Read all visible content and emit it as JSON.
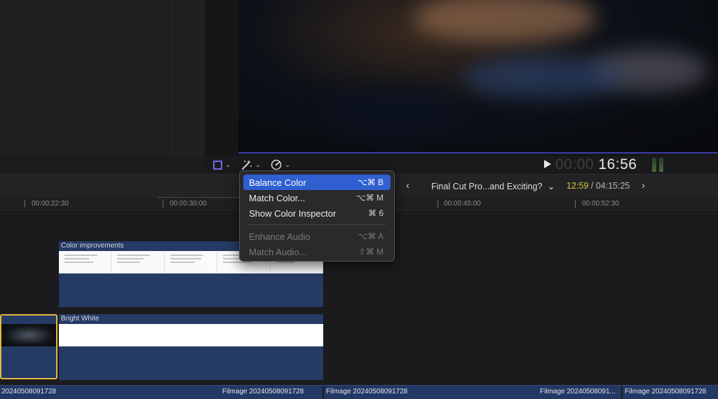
{
  "viewer": {
    "timecode_dim": "00:00",
    "timecode_bright": "16:56"
  },
  "timeline_header": {
    "back_arrow": "‹",
    "project_name": "Final Cut Pro...and Exciting?",
    "project_chevron": "⌄",
    "current_duration": "12:59",
    "duration_separator": " / ",
    "total_duration": "04:15:25",
    "forward_arrow": "›"
  },
  "ruler": {
    "labels": [
      "00:00:22:30",
      "00:00:30:00",
      "00:00:45:00",
      "00:00:52:30"
    ]
  },
  "clips": {
    "color_improvements_title": "Color improvements",
    "bright_white_title": "Bright White"
  },
  "storyline": {
    "labels": [
      "20240508091728",
      "Filmage 20240508091728",
      "Filmage 20240508091728",
      "Filmage 20240508091...",
      "Filmage 20240508091728"
    ]
  },
  "menu": {
    "items": [
      {
        "label": "Balance Color",
        "shortcut": "⌥⌘ B",
        "state": "selected"
      },
      {
        "label": "Match Color...",
        "shortcut": "⌥⌘ M",
        "state": "enabled"
      },
      {
        "label": "Show Color Inspector",
        "shortcut": "⌘ 6",
        "state": "enabled"
      },
      {
        "label": "Enhance Audio",
        "shortcut": "⌥⌘ A",
        "state": "disabled"
      },
      {
        "label": "Match Audio...",
        "shortcut": "⇧⌘ M",
        "state": "disabled"
      }
    ]
  },
  "icons": {
    "crop": "crop-square-icon",
    "magic_wand": "magic-wand-icon",
    "speed": "speedometer-icon",
    "play": "play-icon"
  },
  "colors": {
    "accent": "#6f6cf0",
    "menu_selection": "#2f5fd0",
    "clip_blue": "#253a65",
    "selected_clip_border": "#e2bb3c",
    "duration_current": "#d6c53c"
  }
}
